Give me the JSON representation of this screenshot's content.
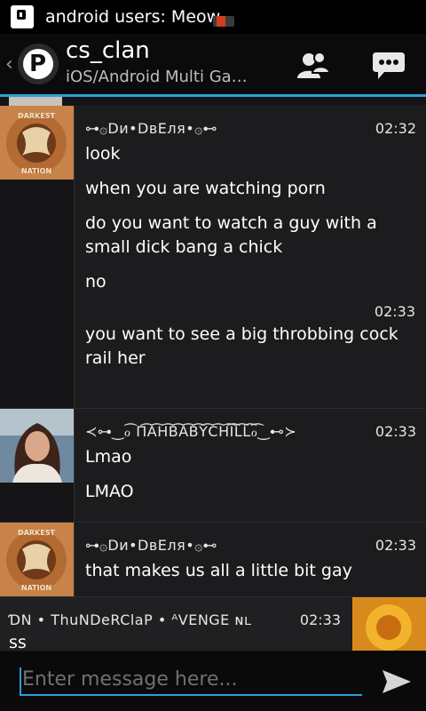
{
  "status_bar": {
    "notification": "android users: Meow"
  },
  "header": {
    "title": "cs_clan",
    "subtitle": "iOS/Android Multi Ga…",
    "accent_color": "#2d9fd6"
  },
  "messages": [
    {
      "sender": "⊶۞Dи•DвEля•۞⊷",
      "time": "02:32",
      "lines": [
        "look",
        "when you are watching porn",
        "do you want to watch a guy with a small dick bang a chick",
        "no"
      ]
    },
    {
      "sender": "",
      "time": "02:33",
      "lines": [
        "you want to see a big throbbing cock rail her"
      ]
    },
    {
      "sender": "≺⊶‿ℴ͡ Π͡Α͡Η͡Β͡Α͡Β͡Υ͡C͡Η͡Ι͡L͡L͡ℴ͡‿⊷≻",
      "time": "02:33",
      "lines": [
        "Lmao",
        "LMAO"
      ]
    },
    {
      "sender": "⊶۞Dи•DвEля•۞⊷",
      "time": "02:33",
      "lines": [
        "that makes us all a little bit gay"
      ]
    },
    {
      "sender": "ƊN • ThuNDeRClaP • ᴬVENGE ɴʟ",
      "time": "02:33",
      "lines": [
        "ss"
      ]
    }
  ],
  "composer": {
    "placeholder": "Enter message here..."
  }
}
